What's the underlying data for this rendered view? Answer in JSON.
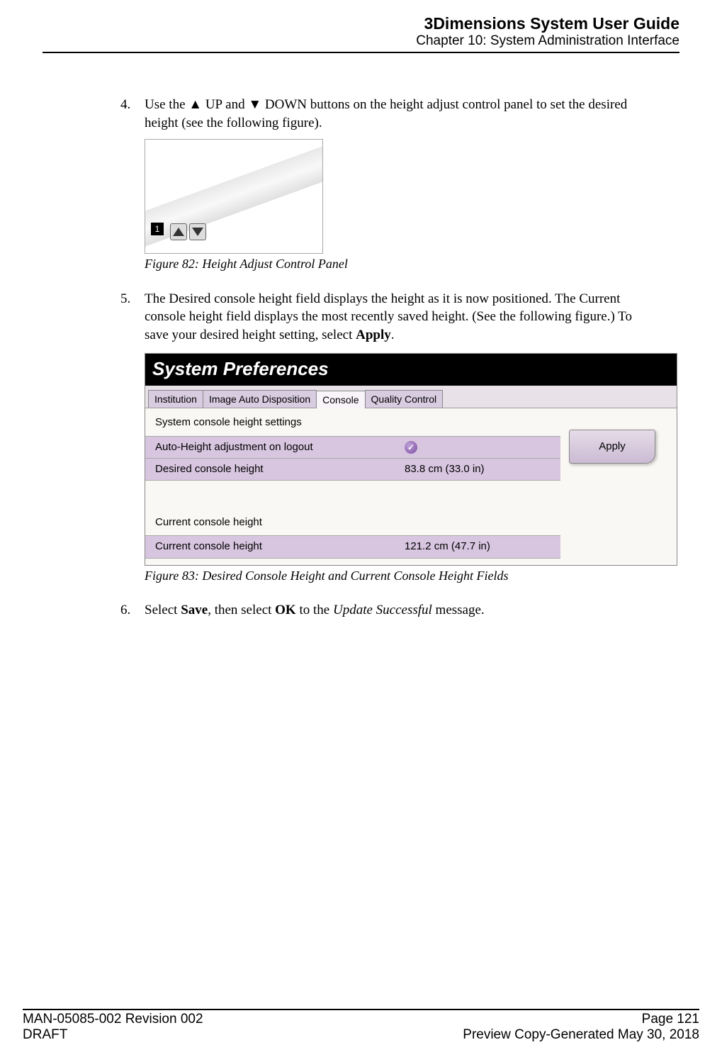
{
  "header": {
    "title": "3Dimensions System User Guide",
    "subtitle": "Chapter 10: System Administration Interface"
  },
  "steps": {
    "s4": {
      "num": "4.",
      "pre": "Use the ",
      "up": "▲",
      "mid1": " UP and ",
      "down": "▼",
      "mid2": " DOWN buttons on the height adjust control panel to set the desired height (see the following figure)."
    },
    "fig82_caption": "Figure 82: Height Adjust Control Panel",
    "fig82_marker": "1",
    "s5": {
      "num": "5.",
      "text_a": "The Desired console height field displays the height as it is now positioned. The Current console height field displays the most recently saved height. (See the following figure.) To save your desired height setting, select ",
      "apply_bold": "Apply",
      "text_b": "."
    },
    "fig83": {
      "title": "System Preferences",
      "tabs": [
        "Institution",
        "Image Auto Disposition",
        "Console",
        "Quality Control"
      ],
      "group1_title": "System console height settings",
      "row_auto": "Auto-Height adjustment on logout",
      "row_desired": "Desired console height",
      "desired_val": "83.8 cm    (33.0 in)",
      "group2_title": "Current console height",
      "row_current": "Current console height",
      "current_val": "121.2 cm    (47.7 in)",
      "apply": "Apply"
    },
    "fig83_caption": "Figure 83: Desired Console Height and Current Console Height Fields",
    "s6": {
      "num": "6.",
      "a": "Select ",
      "save": "Save",
      "b": ", then select ",
      "ok": "OK",
      "c": " to the ",
      "upd": "Update Successful",
      "d": " message."
    }
  },
  "footer": {
    "left1": "MAN-05085-002 Revision 002",
    "left2": "DRAFT",
    "right1": "Page 121",
    "right2": "Preview Copy-Generated May 30, 2018"
  }
}
